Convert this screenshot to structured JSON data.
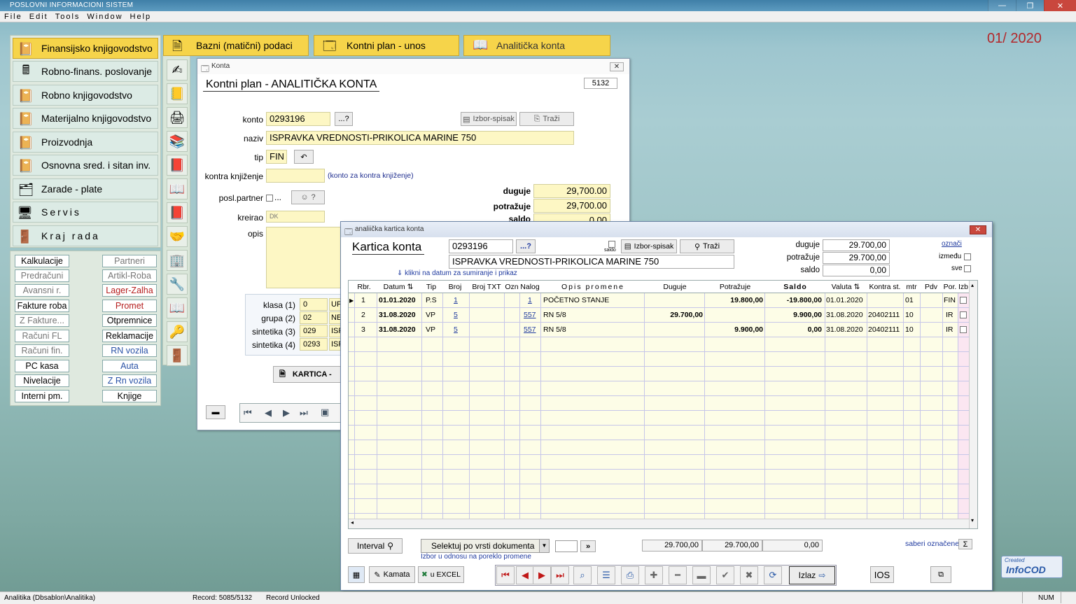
{
  "window_title": "POSLOVNI INFORMACIONI SISTEM",
  "menu": [
    "File",
    "Edit",
    "Tools",
    "Window",
    "Help"
  ],
  "period": "01/ 2020",
  "main_menu": [
    {
      "label": "Finansijsko knjigovodstvo",
      "icon": "ledger-icon"
    },
    {
      "label": "Robno-finans. poslovanje",
      "icon": "cashregister-icon"
    },
    {
      "label": "Robno knjigovodstvo",
      "icon": "ledger-icon"
    },
    {
      "label": "Materijalno knjigovodstvo",
      "icon": "ledger-icon"
    },
    {
      "label": "Proizvodnja",
      "icon": "ledger-icon"
    },
    {
      "label": "Osnovna sred. i sitan inv.",
      "icon": "ledger-icon"
    },
    {
      "label": "Zarade - plate",
      "icon": "payroll-icon"
    },
    {
      "label": "Servis",
      "icon": "computer-icon"
    },
    {
      "label": "Kraj rada",
      "icon": "exit-icon"
    }
  ],
  "quick_left": [
    "Kalkulacije",
    "Predračuni",
    "Avansni r.",
    "Fakture roba",
    "Z Fakture...",
    "Računi FL",
    "Računi fin.",
    "PC kasa",
    "Nivelacije",
    "Interni pm."
  ],
  "quick_right": [
    "Partneri",
    "Artikl-Roba",
    "Lager-Zalha",
    "Promet",
    "Otpremnice",
    "Reklamacije",
    "RN vozila",
    "Auta",
    "Z Rn vozila",
    "Knjige"
  ],
  "top_tabs": [
    "Bazni (matični) podaci",
    "Kontni plan - unos",
    "Analitička konta"
  ],
  "konta": {
    "title": "Konta",
    "heading": "Kontni plan - ANALITIČKA KONTA",
    "count": "5132",
    "konto_label": "konto",
    "konto": "0293196",
    "dots": "...?",
    "izbor": "Izbor-spisak",
    "trazi": "Traži",
    "naziv_label": "naziv",
    "naziv": "ISPRAVKA VREDNOSTI-PRIKOLICA MARINE 750",
    "tip_label": "tip",
    "tip": "FIN",
    "kontra_label": "kontra knjiženje",
    "kontra_hint": "(konto za kontra knjiženje)",
    "posl_label": "posl.partner",
    "posl_dots": "...",
    "posl_q": "?",
    "kreirao_label": "kreirao",
    "kreirao": "DK",
    "opis_label": "opis",
    "duguje_label": "duguje",
    "duguje": "29,700.00",
    "potrazuje_label": "potražuje",
    "potrazuje": "29,700.00",
    "saldo_label": "saldo",
    "saldo": "0.00",
    "hier": [
      {
        "label": "klasa (1)",
        "code": "0",
        "name": "UF"
      },
      {
        "label": "grupa (2)",
        "code": "02",
        "name": "NE"
      },
      {
        "label": "sintetika (3)",
        "code": "029",
        "name": "ISF"
      },
      {
        "label": "sintetika (4)",
        "code": "0293",
        "name": "ISF"
      }
    ],
    "kartica_btn": "KARTICA -"
  },
  "kartica": {
    "title": "analiička kartica konta",
    "heading": "Kartica konta",
    "konto": "0293196",
    "dots": "...?",
    "saldo_chk": "saldo",
    "izbor": "Izbor-spisak",
    "trazi": "Traži",
    "naziv": "ISPRAVKA VREDNOSTI-PRIKOLICA MARINE 750",
    "hint": "klikni na datum za sumiranje i prikaz",
    "duguje_label": "duguje",
    "duguje": "29.700,00",
    "potrazuje_label": "potražuje",
    "potrazuje": "29.700,00",
    "saldo_label": "saldo",
    "saldo": "0,00",
    "oznaci": "označi",
    "izmedu": "između",
    "sve": "sve",
    "columns": [
      "Rbr.",
      "Datum",
      "Tip",
      "Broj",
      "Broj TXT",
      "Ozn",
      "Nalog",
      "Opis promene",
      "Duguje",
      "Potražuje",
      "Saldo",
      "Valuta",
      "Kontra st.",
      "mtr",
      "Pdv",
      "Por.",
      "Izb"
    ],
    "rows": [
      {
        "rbr": "1",
        "datum": "01.01.2020",
        "tip": "P.S",
        "broj": "1",
        "broj_txt": "",
        "ozn": "",
        "nalog": "1",
        "opis": "POČETNO STANJE",
        "duguje": "",
        "potrazuje": "19.800,00",
        "saldo": "-19.800,00",
        "valuta": "01.01.2020",
        "kontra": "",
        "mtr": "01",
        "pdv": "",
        "por": "FIN"
      },
      {
        "rbr": "2",
        "datum": "31.08.2020",
        "tip": "VP",
        "broj": "5",
        "broj_txt": "",
        "ozn": "",
        "nalog": "557",
        "opis": "RN 5/8",
        "duguje": "29.700,00",
        "potrazuje": "",
        "saldo": "9.900,00",
        "valuta": "31.08.2020",
        "kontra": "20402111",
        "mtr": "10",
        "pdv": "",
        "por": "IR"
      },
      {
        "rbr": "3",
        "datum": "31.08.2020",
        "tip": "VP",
        "broj": "5",
        "broj_txt": "",
        "ozn": "",
        "nalog": "557",
        "opis": "RN 5/8",
        "duguje": "",
        "potrazuje": "9.900,00",
        "saldo": "0,00",
        "valuta": "31.08.2020",
        "kontra": "20402111",
        "mtr": "10",
        "pdv": "",
        "por": "IR"
      }
    ],
    "interval": "Interval",
    "selektuj": "Selektuj po vrsti dokumenta",
    "izbor_hint": "Izbor u odnosu na poreklo promene",
    "go": "»",
    "sum_duguje": "29.700,00",
    "sum_potrazuje": "29.700,00",
    "sum_saldo": "0,00",
    "saberi": "saberi označene",
    "sigma": "Σ",
    "kamata": "Kamata",
    "excel": "u EXCEL",
    "izlaz": "Izlaz",
    "ios": "IOS"
  },
  "logo_small": "Created",
  "logo": "InfoCOD",
  "status": {
    "left": "Analitika (Dbsablon\\Analitika)",
    "record": "Record: 5085/5132",
    "lock": "Record Unlocked",
    "num": "NUM"
  }
}
